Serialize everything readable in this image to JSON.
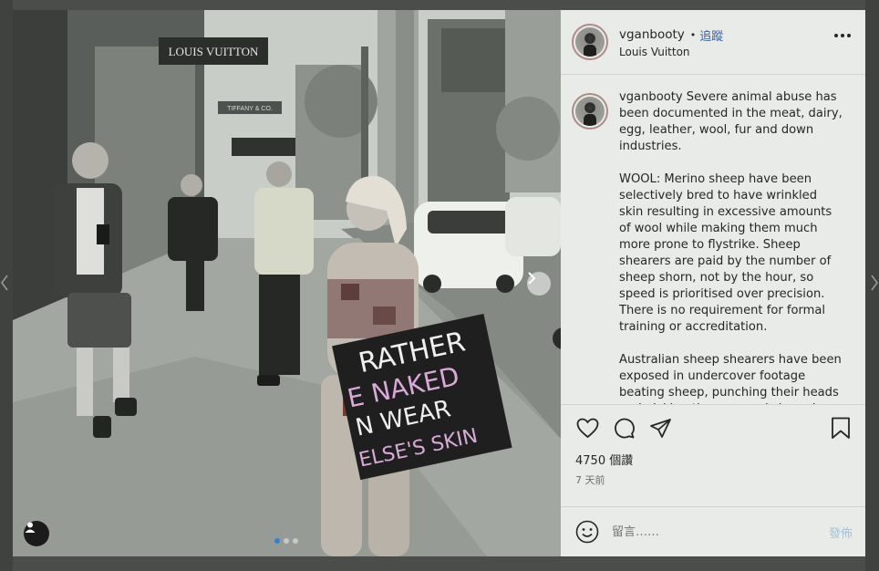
{
  "photo": {
    "store_sign": "LOUIS VUITTON",
    "store_sign_small": "TIFFANY & CO.",
    "placard_lines": [
      "RATHER",
      "E NAKED",
      "N WEAR",
      "ELSE'S SKIN"
    ],
    "carousel_count": 3,
    "carousel_active": 0
  },
  "post_header": {
    "username": "vganbooty",
    "separator": "•",
    "follow_label": "追蹤",
    "location": "Louis Vuitton",
    "more_icon": "more-options-icon"
  },
  "caption": {
    "username": "vganbooty",
    "paragraphs": [
      "Severe animal abuse has been documented in the meat, dairy, egg, leather, wool, fur and down industries.",
      "WOOL: Merino sheep have been selectively bred to have wrinkled skin resulting in excessive amounts of wool while making them much more prone to flystrike. Sheep shearers are paid by the number of sheep shorn, not by the hour, so speed is prioritised over precision. There is no requirement for formal training or accreditation.",
      "Australian sheep shearers have been exposed in undercover footage beating sheep, punching their heads and picking them up and slamming their body onto the ground whilst"
    ]
  },
  "actions": {
    "icons": [
      "heart-icon",
      "comment-icon",
      "share-icon",
      "bookmark-icon"
    ]
  },
  "likes": "4750 個讚",
  "age": "7 天前",
  "comment_box": {
    "placeholder": "留言……",
    "post_label": "發佈",
    "emoji_icon": "emoji-icon"
  },
  "colors": {
    "panel_bg": "#e8ebe7",
    "follow_link": "#3a5fa0",
    "post_disabled": "#a9bed8",
    "active_dot": "#2f83d6"
  }
}
